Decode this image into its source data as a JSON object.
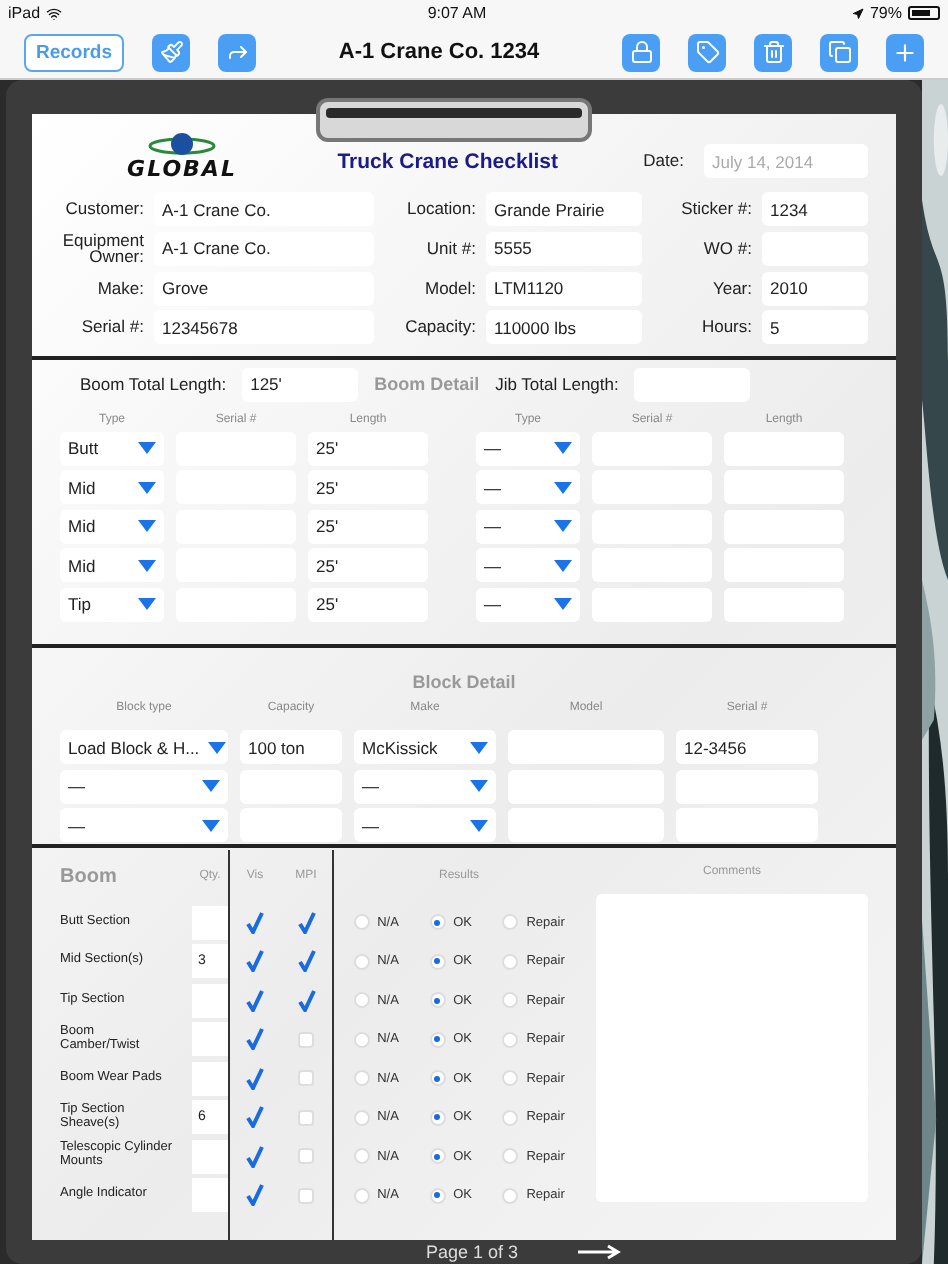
{
  "status_bar": {
    "device": "iPad",
    "time": "9:07 AM",
    "battery": "79%"
  },
  "toolbar": {
    "records_button": "Records",
    "title": "A-1 Crane Co. 1234"
  },
  "form": {
    "logo": "GLOBAL",
    "title": "Truck Crane Checklist",
    "date": {
      "label": "Date:",
      "placeholder": "July 14, 2014"
    },
    "info_rows": [
      [
        {
          "label": "Customer:",
          "value": "A-1 Crane Co."
        },
        {
          "label": "Location:",
          "value": "Grande Prairie"
        },
        {
          "label": "Sticker #:",
          "value": "1234"
        }
      ],
      [
        {
          "label": "Equipment Owner:",
          "value": "A-1 Crane Co."
        },
        {
          "label": "Unit #:",
          "value": "5555"
        },
        {
          "label": "WO #:"
        }
      ],
      [
        {
          "label": "Make:",
          "value": "Grove"
        },
        {
          "label": "Model:",
          "value": "LTM1120"
        },
        {
          "label": "Year:",
          "value": "2010"
        }
      ],
      [
        {
          "label": "Serial #:",
          "value": "12345678"
        },
        {
          "label": "Capacity:",
          "value": "110000 lbs"
        },
        {
          "label": "Hours:",
          "value": "5"
        }
      ]
    ],
    "boom": {
      "total_label": "Boom Total Length:",
      "total_value": "125'",
      "title": "Boom Detail",
      "jib_label": "Jib Total Length:",
      "columns": [
        "Type",
        "Serial #",
        "Length",
        "Type",
        "Serial #",
        "Length"
      ],
      "rows": [
        {
          "type": "Butt",
          "length": "25'",
          "jib_type": "—"
        },
        {
          "type": "Mid",
          "length": "25'",
          "jib_type": "—"
        },
        {
          "type": "Mid",
          "length": "25'",
          "jib_type": "—"
        },
        {
          "type": "Mid",
          "length": "25'",
          "jib_type": "—"
        },
        {
          "type": "Tip",
          "length": "25'",
          "jib_type": "—"
        }
      ]
    },
    "block": {
      "title": "Block Detail",
      "columns": [
        "Block type",
        "Capacity",
        "Make",
        "Model",
        "Serial #"
      ],
      "rows": [
        {
          "type": "Load Block & H...",
          "capacity": "100 ton",
          "make": "McKissick",
          "serial": "12-3456"
        },
        {
          "type": "—",
          "make": "—"
        },
        {
          "type": "—",
          "make": "—"
        }
      ]
    },
    "inspection": {
      "title": "Boom",
      "columns": {
        "qty": "Qty.",
        "vis": "Vis",
        "mpi": "MPI",
        "results": "Results",
        "comments": "Comments"
      },
      "rows": [
        {
          "label": "Butt Section",
          "vis": true,
          "mpi": true,
          "options": [
            {
              "label": "N/A",
              "selected": false
            },
            {
              "label": "OK",
              "selected": true
            },
            {
              "label": "Repair",
              "selected": false
            }
          ]
        },
        {
          "label": "Mid Section(s)",
          "qty": "3",
          "vis": true,
          "mpi": true,
          "options": [
            {
              "label": "N/A",
              "selected": false
            },
            {
              "label": "OK",
              "selected": true
            },
            {
              "label": "Repair",
              "selected": false
            }
          ]
        },
        {
          "label": "Tip Section",
          "vis": true,
          "mpi": true,
          "options": [
            {
              "label": "N/A",
              "selected": false
            },
            {
              "label": "OK",
              "selected": true
            },
            {
              "label": "Repair",
              "selected": false
            }
          ]
        },
        {
          "label": "Boom Camber/Twist",
          "vis": true,
          "mpi": false,
          "options": [
            {
              "label": "N/A",
              "selected": false
            },
            {
              "label": "OK",
              "selected": true
            },
            {
              "label": "Repair",
              "selected": false
            }
          ]
        },
        {
          "label": "Boom Wear Pads",
          "vis": true,
          "mpi": false,
          "options": [
            {
              "label": "N/A",
              "selected": false
            },
            {
              "label": "OK",
              "selected": true
            },
            {
              "label": "Repair",
              "selected": false
            }
          ]
        },
        {
          "label": "Tip Section Sheave(s)",
          "qty": "6",
          "vis": true,
          "mpi": false,
          "options": [
            {
              "label": "N/A",
              "selected": false
            },
            {
              "label": "OK",
              "selected": true
            },
            {
              "label": "Repair",
              "selected": false
            }
          ]
        },
        {
          "label": "Telescopic Cylinder Mounts",
          "vis": true,
          "mpi": false,
          "options": [
            {
              "label": "N/A",
              "selected": false
            },
            {
              "label": "OK",
              "selected": true
            },
            {
              "label": "Repair",
              "selected": false
            }
          ]
        },
        {
          "label": "Angle Indicator",
          "vis": true,
          "mpi": false,
          "options": [
            {
              "label": "N/A",
              "selected": false
            },
            {
              "label": "OK",
              "selected": true
            },
            {
              "label": "Repair",
              "selected": false
            }
          ]
        }
      ]
    }
  },
  "footer": {
    "page": "Page 1 of 3"
  }
}
